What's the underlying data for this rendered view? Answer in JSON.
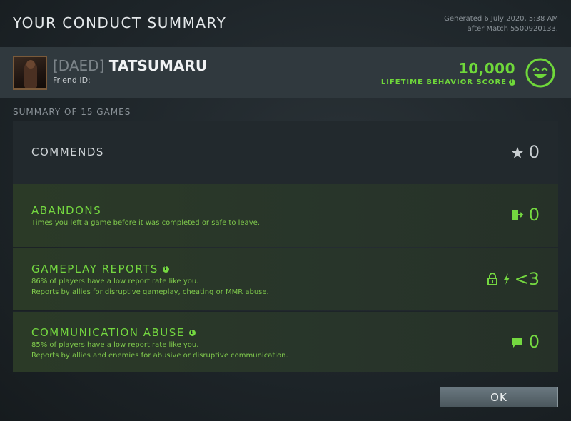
{
  "header": {
    "title": "YOUR CONDUCT SUMMARY",
    "generated_line1": "Generated 6 July 2020, 5:38 AM",
    "generated_line2": "after Match 5500920133."
  },
  "profile": {
    "tag": "[DAED]",
    "name": "TATSUMARU",
    "friend_id_label": "Friend ID:",
    "score": "10,000",
    "score_label": "LIFETIME BEHAVIOR SCORE"
  },
  "summary": {
    "label": "SUMMARY OF 15 GAMES"
  },
  "cards": {
    "commends": {
      "title": "COMMENDS",
      "value": "0",
      "icon": "star-icon"
    },
    "abandons": {
      "title": "ABANDONS",
      "desc": "Times you left a game before it was completed or safe to leave.",
      "value": "0",
      "icon": "exit-door-icon"
    },
    "gameplay": {
      "title": "GAMEPLAY REPORTS",
      "desc1": "86% of players have a low report rate like you.",
      "desc2": "Reports by allies for disruptive gameplay, cheating or MMR abuse.",
      "value": "<3",
      "icons": [
        "lock-icon",
        "lightning-icon"
      ]
    },
    "communication": {
      "title": "COMMUNICATION ABUSE",
      "desc1": "85% of players have a low report rate like you.",
      "desc2": "Reports by allies and enemies for abusive or disruptive communication.",
      "value": "0",
      "icon": "chat-bubble-icon"
    }
  },
  "footer": {
    "ok_label": "OK"
  },
  "colors": {
    "accent_green": "#6fd83a",
    "card_good": "#2b3a27",
    "card_neutral": "#22292d"
  }
}
